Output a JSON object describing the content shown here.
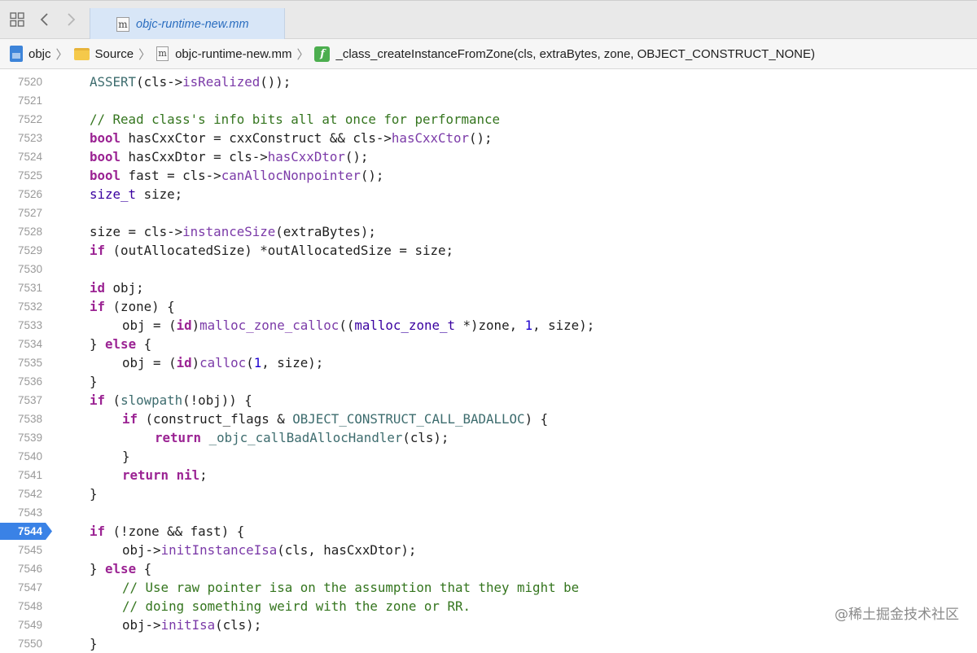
{
  "tab": {
    "file_name": "objc-runtime-new.mm",
    "icon": "m"
  },
  "breadcrumb": {
    "project": "objc",
    "folder": "Source",
    "file": "objc-runtime-new.mm",
    "function_icon": "f",
    "function": "_class_createInstanceFromZone(cls, extraBytes, zone, OBJECT_CONSTRUCT_NONE)"
  },
  "editor": {
    "breakpoint_line": "7544",
    "lines": [
      {
        "no": "7520",
        "indent": 0,
        "tokens": [
          {
            "t": "ASSERT",
            "c": "m"
          },
          {
            "t": "(cls->"
          },
          {
            "t": "isRealized",
            "c": "f"
          },
          {
            "t": "());"
          }
        ]
      },
      {
        "no": "7521",
        "indent": 0,
        "tokens": []
      },
      {
        "no": "7522",
        "indent": 0,
        "tokens": [
          {
            "t": "// Read class's info bits all at once for performance",
            "c": "c"
          }
        ]
      },
      {
        "no": "7523",
        "indent": 0,
        "tokens": [
          {
            "t": "bool",
            "c": "k"
          },
          {
            "t": " hasCxxCtor = cxxConstruct && cls->"
          },
          {
            "t": "hasCxxCtor",
            "c": "f"
          },
          {
            "t": "();"
          }
        ]
      },
      {
        "no": "7524",
        "indent": 0,
        "tokens": [
          {
            "t": "bool",
            "c": "k"
          },
          {
            "t": " hasCxxDtor = cls->"
          },
          {
            "t": "hasCxxDtor",
            "c": "f"
          },
          {
            "t": "();"
          }
        ]
      },
      {
        "no": "7525",
        "indent": 0,
        "tokens": [
          {
            "t": "bool",
            "c": "k"
          },
          {
            "t": " fast = cls->"
          },
          {
            "t": "canAllocNonpointer",
            "c": "f"
          },
          {
            "t": "();"
          }
        ]
      },
      {
        "no": "7526",
        "indent": 0,
        "tokens": [
          {
            "t": "size_t",
            "c": "t"
          },
          {
            "t": " size;"
          }
        ]
      },
      {
        "no": "7527",
        "indent": 0,
        "tokens": []
      },
      {
        "no": "7528",
        "indent": 0,
        "tokens": [
          {
            "t": "size = cls->"
          },
          {
            "t": "instanceSize",
            "c": "f"
          },
          {
            "t": "(extraBytes);"
          }
        ]
      },
      {
        "no": "7529",
        "indent": 0,
        "tokens": [
          {
            "t": "if",
            "c": "k"
          },
          {
            "t": " (outAllocatedSize) *outAllocatedSize = size;"
          }
        ]
      },
      {
        "no": "7530",
        "indent": 0,
        "tokens": []
      },
      {
        "no": "7531",
        "indent": 0,
        "tokens": [
          {
            "t": "id",
            "c": "k"
          },
          {
            "t": " obj;"
          }
        ]
      },
      {
        "no": "7532",
        "indent": 0,
        "tokens": [
          {
            "t": "if",
            "c": "k"
          },
          {
            "t": " (zone) {"
          }
        ]
      },
      {
        "no": "7533",
        "indent": 1,
        "tokens": [
          {
            "t": "obj = ("
          },
          {
            "t": "id",
            "c": "k"
          },
          {
            "t": ")"
          },
          {
            "t": "malloc_zone_calloc",
            "c": "f"
          },
          {
            "t": "(("
          },
          {
            "t": "malloc_zone_t",
            "c": "t"
          },
          {
            "t": " *)zone, "
          },
          {
            "t": "1",
            "c": "n"
          },
          {
            "t": ", size);"
          }
        ]
      },
      {
        "no": "7534",
        "indent": 0,
        "tokens": [
          {
            "t": "} "
          },
          {
            "t": "else",
            "c": "k"
          },
          {
            "t": " {"
          }
        ]
      },
      {
        "no": "7535",
        "indent": 1,
        "tokens": [
          {
            "t": "obj = ("
          },
          {
            "t": "id",
            "c": "k"
          },
          {
            "t": ")"
          },
          {
            "t": "calloc",
            "c": "f"
          },
          {
            "t": "("
          },
          {
            "t": "1",
            "c": "n"
          },
          {
            "t": ", size);"
          }
        ]
      },
      {
        "no": "7536",
        "indent": 0,
        "tokens": [
          {
            "t": "}"
          }
        ]
      },
      {
        "no": "7537",
        "indent": 0,
        "tokens": [
          {
            "t": "if",
            "c": "k"
          },
          {
            "t": " ("
          },
          {
            "t": "slowpath",
            "c": "m"
          },
          {
            "t": "(!obj)) {"
          }
        ]
      },
      {
        "no": "7538",
        "indent": 1,
        "tokens": [
          {
            "t": "if",
            "c": "k"
          },
          {
            "t": " (construct_flags & "
          },
          {
            "t": "OBJECT_CONSTRUCT_CALL_BADALLOC",
            "c": "m"
          },
          {
            "t": ") {"
          }
        ]
      },
      {
        "no": "7539",
        "indent": 2,
        "tokens": [
          {
            "t": "return",
            "c": "k"
          },
          {
            "t": " "
          },
          {
            "t": "_objc_callBadAllocHandler",
            "c": "m"
          },
          {
            "t": "(cls);"
          }
        ]
      },
      {
        "no": "7540",
        "indent": 1,
        "tokens": [
          {
            "t": "}"
          }
        ]
      },
      {
        "no": "7541",
        "indent": 1,
        "tokens": [
          {
            "t": "return",
            "c": "k"
          },
          {
            "t": " "
          },
          {
            "t": "nil",
            "c": "k"
          },
          {
            "t": ";"
          }
        ]
      },
      {
        "no": "7542",
        "indent": 0,
        "tokens": [
          {
            "t": "}"
          }
        ]
      },
      {
        "no": "7543",
        "indent": 0,
        "tokens": []
      },
      {
        "no": "7544",
        "indent": 0,
        "tokens": [
          {
            "t": "if",
            "c": "k"
          },
          {
            "t": " (!zone && fast) {"
          }
        ]
      },
      {
        "no": "7545",
        "indent": 1,
        "tokens": [
          {
            "t": "obj->"
          },
          {
            "t": "initInstanceIsa",
            "c": "f"
          },
          {
            "t": "(cls, hasCxxDtor);"
          }
        ]
      },
      {
        "no": "7546",
        "indent": 0,
        "tokens": [
          {
            "t": "} "
          },
          {
            "t": "else",
            "c": "k"
          },
          {
            "t": " {"
          }
        ]
      },
      {
        "no": "7547",
        "indent": 1,
        "tokens": [
          {
            "t": "// Use raw pointer isa on the assumption that they might be",
            "c": "c"
          }
        ]
      },
      {
        "no": "7548",
        "indent": 1,
        "tokens": [
          {
            "t": "// doing something weird with the zone or RR.",
            "c": "c"
          }
        ]
      },
      {
        "no": "7549",
        "indent": 1,
        "tokens": [
          {
            "t": "obj->"
          },
          {
            "t": "initIsa",
            "c": "f"
          },
          {
            "t": "(cls);"
          }
        ]
      },
      {
        "no": "7550",
        "indent": 0,
        "tokens": [
          {
            "t": "}"
          }
        ]
      }
    ]
  },
  "watermark": "@稀土掘金技术社区"
}
